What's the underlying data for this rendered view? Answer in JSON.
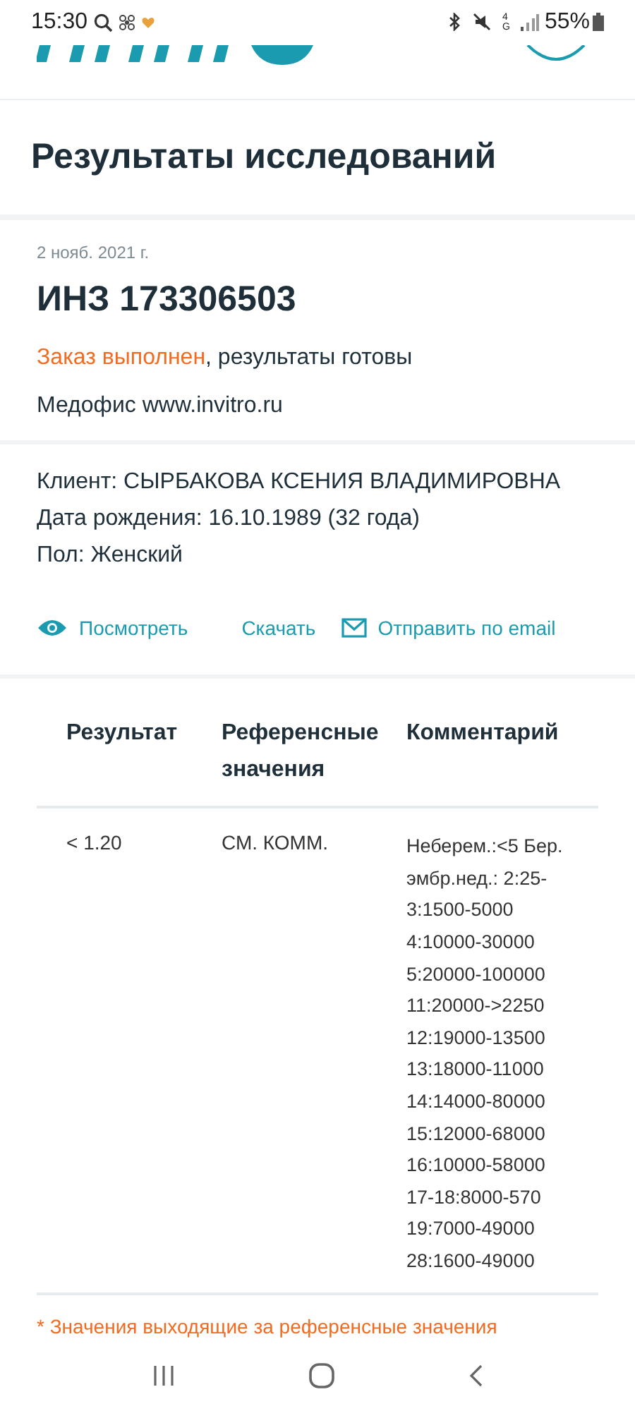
{
  "status_bar": {
    "time": "15:30",
    "battery": "55%",
    "network": "4G"
  },
  "page_title": "Результаты исследований",
  "order": {
    "date": "2 нояб. 2021 г.",
    "number": "ИНЗ 173306503",
    "status": "Заказ выполнен",
    "status_rest": ", результаты готовы",
    "office": "Медофис www.invitro.ru"
  },
  "client": [
    "Клиент: СЫРБАКОВА КСЕНИЯ ВЛАДИМИРОВНА",
    "Дата рождения: 16.10.1989 (32 года)",
    "Пол: Женский"
  ],
  "actions": [
    {
      "kind": "view",
      "label": "Посмотреть"
    },
    {
      "kind": "download",
      "label": "Скачать"
    },
    {
      "kind": "email",
      "label": "Отправить по email"
    }
  ],
  "table": {
    "columns": [
      "Результат",
      "Референсные значения",
      "Комментарий"
    ],
    "rows": [
      {
        "result": "< 1.20",
        "reference": "СМ. КОММ.",
        "comment": [
          "Неберем.:<5 Бер.",
          "эмбр.нед.: 2:25-",
          "3:1500-5000",
          "4:10000-30000",
          "5:20000-100000",
          "11:20000->2250",
          "12:19000-13500",
          "13:18000-11000",
          "14:14000-80000",
          "15:12000-68000",
          "16:10000-58000",
          "17-18:8000-570",
          "19:7000-49000",
          "28:1600-49000"
        ]
      }
    ]
  },
  "footnote": "* Значения выходящие за референсные значения"
}
